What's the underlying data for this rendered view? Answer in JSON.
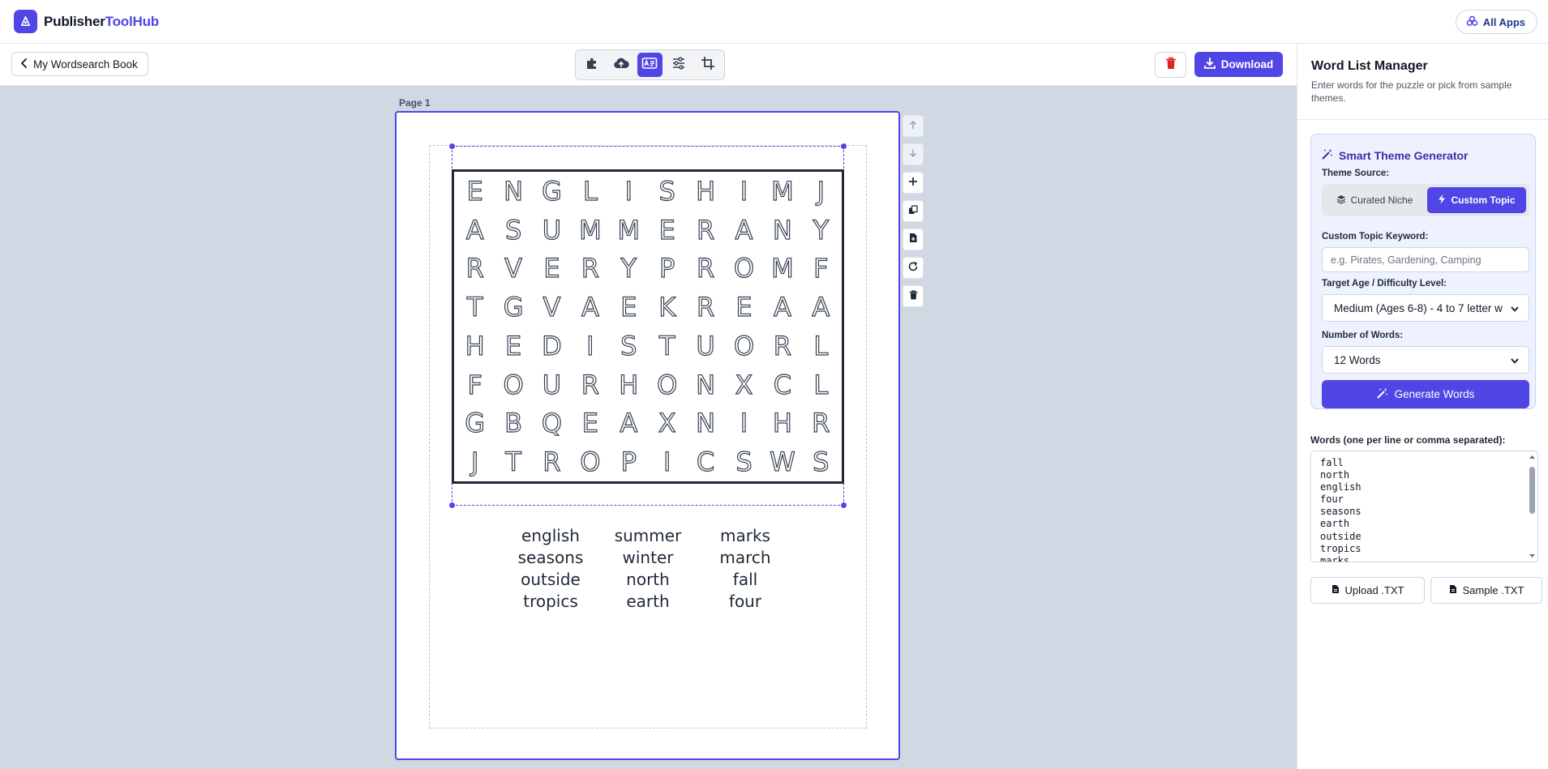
{
  "app": {
    "brand_main": "Publisher",
    "brand_accent": "ToolHub",
    "all_apps": "All Apps"
  },
  "toolbar": {
    "back_label": "My Wordsearch Book",
    "download_label": "Download",
    "tools": [
      "puzzle-icon",
      "cloud-upload-icon",
      "layout-icon",
      "sliders-icon",
      "crop-icon"
    ],
    "active_tool": "layout-icon"
  },
  "canvas": {
    "page_label": "Page 1",
    "grid": [
      [
        "E",
        "N",
        "G",
        "L",
        "I",
        "S",
        "H",
        "I",
        "M",
        "J"
      ],
      [
        "A",
        "S",
        "U",
        "M",
        "M",
        "E",
        "R",
        "A",
        "N",
        "Y"
      ],
      [
        "R",
        "V",
        "E",
        "R",
        "Y",
        "P",
        "R",
        "O",
        "M",
        "F"
      ],
      [
        "T",
        "G",
        "V",
        "A",
        "E",
        "K",
        "R",
        "E",
        "A",
        "A"
      ],
      [
        "H",
        "E",
        "D",
        "I",
        "S",
        "T",
        "U",
        "O",
        "R",
        "L"
      ],
      [
        "F",
        "O",
        "U",
        "R",
        "H",
        "O",
        "N",
        "X",
        "C",
        "L"
      ],
      [
        "G",
        "B",
        "Q",
        "E",
        "A",
        "X",
        "N",
        "I",
        "H",
        "R"
      ],
      [
        "J",
        "T",
        "R",
        "O",
        "P",
        "I",
        "C",
        "S",
        "W",
        "S"
      ]
    ],
    "word_list": [
      "english",
      "summer",
      "marks",
      "seasons",
      "winter",
      "march",
      "outside",
      "north",
      "fall",
      "tropics",
      "earth",
      "four"
    ]
  },
  "panel": {
    "title": "Word List Manager",
    "subtitle": "Enter words for the puzzle or pick from sample themes.",
    "generator": {
      "title": "Smart Theme Generator",
      "source_label": "Theme Source:",
      "source_options": [
        "Curated Niche",
        "Custom Topic"
      ],
      "source_selected": "Custom Topic",
      "keyword_label": "Custom Topic Keyword:",
      "keyword_placeholder": "e.g. Pirates, Gardening, Camping",
      "keyword_value": "",
      "difficulty_label": "Target Age / Difficulty Level:",
      "difficulty_value": "Medium (Ages 6-8) - 4 to 7 letter w",
      "count_label": "Number of Words:",
      "count_value": "12 Words",
      "generate_label": "Generate Words"
    },
    "words_label": "Words (one per line or comma separated):",
    "words_text": [
      "fall",
      "north",
      "english",
      "four",
      "seasons",
      "earth",
      "outside",
      "tropics",
      "marks"
    ],
    "upload_label": "Upload .TXT",
    "sample_label": "Sample .TXT"
  },
  "colors": {
    "accent": "#4f46e5",
    "canvas_bg": "#cfd8e3",
    "danger": "#dc2626"
  }
}
